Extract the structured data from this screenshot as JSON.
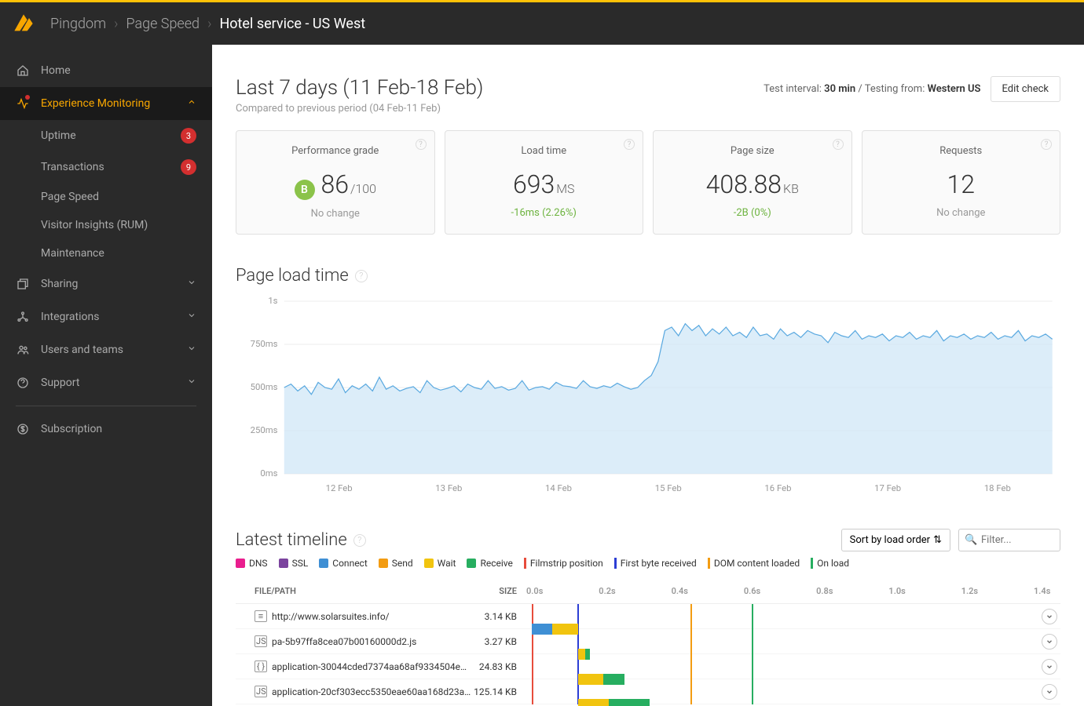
{
  "breadcrumb": {
    "root": "Pingdom",
    "mid": "Page Speed",
    "current": "Hotel service - US West"
  },
  "sidebar": {
    "home": "Home",
    "experience": "Experience Monitoring",
    "items": [
      {
        "label": "Uptime",
        "badge": "3"
      },
      {
        "label": "Transactions",
        "badge": "9"
      },
      {
        "label": "Page Speed",
        "badge": ""
      },
      {
        "label": "Visitor Insights (RUM)",
        "badge": ""
      },
      {
        "label": "Maintenance",
        "badge": ""
      }
    ],
    "sharing": "Sharing",
    "integrations": "Integrations",
    "users": "Users and teams",
    "support": "Support",
    "subscription": "Subscription"
  },
  "range": {
    "title": "Last 7 days (11 Feb-18 Feb)",
    "sub": "Compared to previous period (04 Feb-11 Feb)",
    "interval_label": "Test interval:",
    "interval_value": "30 min",
    "from_label": " / Testing from:",
    "from_value": "Western US",
    "edit": "Edit check"
  },
  "cards": [
    {
      "label": "Performance grade",
      "grade": "B",
      "value": "86",
      "unit": "/100",
      "delta": "No change",
      "delta_class": "delta-gray"
    },
    {
      "label": "Load time",
      "value": "693",
      "unit": "MS",
      "delta": "-16ms (2.26%)",
      "delta_class": "delta-green"
    },
    {
      "label": "Page size",
      "value": "408.88",
      "unit": "KB",
      "delta": "-2B (0%)",
      "delta_class": "delta-green"
    },
    {
      "label": "Requests",
      "value": "12",
      "unit": "",
      "delta": "No change",
      "delta_class": "delta-gray"
    }
  ],
  "chart_section_title": "Page load time",
  "chart_data": {
    "type": "area",
    "ylabel": "load time",
    "ylim": [
      0,
      1000
    ],
    "y_ticks": [
      "0ms",
      "250ms",
      "500ms",
      "750ms",
      "1s"
    ],
    "x_ticks": [
      "12 Feb",
      "13 Feb",
      "14 Feb",
      "15 Feb",
      "16 Feb",
      "17 Feb",
      "18 Feb"
    ],
    "series": [
      {
        "name": "Load time",
        "values": [
          500,
          520,
          480,
          510,
          460,
          530,
          500,
          490,
          550,
          470,
          510,
          490,
          520,
          480,
          560,
          490,
          510,
          480,
          495,
          505,
          470,
          540,
          500,
          485,
          495,
          510,
          475,
          520,
          500,
          490,
          540,
          495,
          505,
          485,
          495,
          540,
          485,
          500,
          505,
          490,
          530,
          510,
          505,
          495,
          540,
          505,
          495,
          510,
          500,
          525,
          505,
          490,
          500,
          540,
          570,
          650,
          830,
          850,
          800,
          870,
          830,
          860,
          800,
          840,
          810,
          850,
          800,
          820,
          790,
          850,
          800,
          810,
          780,
          840,
          800,
          820,
          790,
          830,
          810,
          800,
          760,
          820,
          800,
          790,
          830,
          780,
          800,
          790,
          810,
          770,
          800,
          790,
          820,
          780,
          800,
          790,
          830,
          770,
          800,
          790,
          810,
          780,
          800,
          790,
          820,
          780,
          800,
          790,
          830,
          770,
          800,
          790,
          810,
          780
        ]
      }
    ]
  },
  "timeline": {
    "title": "Latest timeline",
    "sort": "Sort by load order",
    "filter_placeholder": "Filter...",
    "legend": [
      {
        "label": "DNS",
        "color": "#e91e8e",
        "type": "box"
      },
      {
        "label": "SSL",
        "color": "#7b439e",
        "type": "box"
      },
      {
        "label": "Connect",
        "color": "#3f8fd4",
        "type": "box"
      },
      {
        "label": "Send",
        "color": "#f39c12",
        "type": "box"
      },
      {
        "label": "Wait",
        "color": "#f1c40f",
        "type": "box"
      },
      {
        "label": "Receive",
        "color": "#27ae60",
        "type": "box"
      },
      {
        "label": "Filmstrip position",
        "color": "#e74c3c",
        "type": "line"
      },
      {
        "label": "First byte received",
        "color": "#2c3ed4",
        "type": "line"
      },
      {
        "label": "DOM content loaded",
        "color": "#f39c12",
        "type": "line"
      },
      {
        "label": "On load",
        "color": "#27ae60",
        "type": "line"
      }
    ],
    "head": {
      "file": "FILE/PATH",
      "size": "SIZE"
    },
    "ticks": [
      "0.0s",
      "0.2s",
      "0.4s",
      "0.6s",
      "0.8s",
      "1.0s",
      "1.2s",
      "1.4s"
    ],
    "markers": [
      {
        "pos": 1,
        "color": "#e74c3c"
      },
      {
        "pos": 10,
        "color": "#2c3ed4"
      },
      {
        "pos": 32,
        "color": "#f39c12"
      },
      {
        "pos": 44,
        "color": "#27ae60"
      }
    ],
    "rows": [
      {
        "icon": "≡",
        "name": "http://www.solarsuites.info/",
        "size": "3.14 KB",
        "segs": [
          {
            "x": 1,
            "w": 4,
            "c": "#3f8fd4"
          },
          {
            "x": 5,
            "w": 5,
            "c": "#f1c40f"
          }
        ]
      },
      {
        "icon": "JS",
        "name": "pa-5b97ffa8cea07b00160000d2.js",
        "size": "3.27 KB",
        "segs": [
          {
            "x": 10,
            "w": 1.5,
            "c": "#f1c40f"
          },
          {
            "x": 11.5,
            "w": 0.8,
            "c": "#27ae60"
          }
        ]
      },
      {
        "icon": "{ }",
        "name": "application-30044cded7374aa68af9334504e6…",
        "size": "24.83 KB",
        "segs": [
          {
            "x": 10,
            "w": 5,
            "c": "#f1c40f"
          },
          {
            "x": 15,
            "w": 4,
            "c": "#27ae60"
          }
        ]
      },
      {
        "icon": "JS",
        "name": "application-20cf303ecc5350eae60aa168d23a…",
        "size": "125.14 KB",
        "segs": [
          {
            "x": 10,
            "w": 6,
            "c": "#f1c40f"
          },
          {
            "x": 16,
            "w": 8,
            "c": "#27ae60"
          }
        ]
      }
    ]
  }
}
